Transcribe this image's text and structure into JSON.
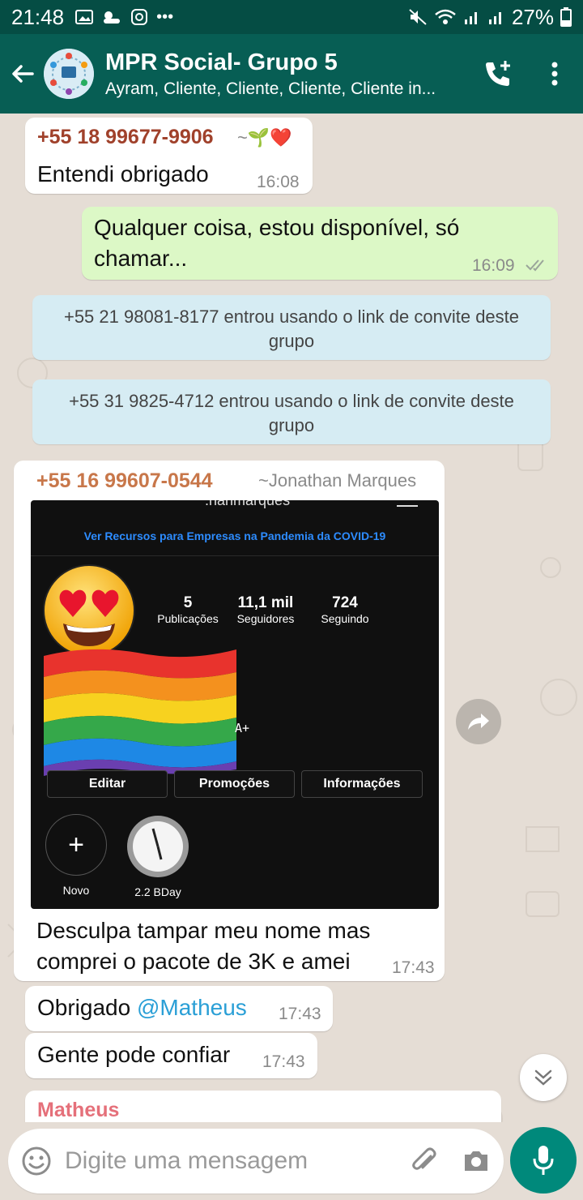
{
  "status_bar": {
    "time": "21:48",
    "battery": "27%"
  },
  "header": {
    "title": "MPR Social- Grupo 5",
    "subtitle": "Ayram, Cliente, Cliente, Cliente, Cliente in..."
  },
  "messages": [
    {
      "sender": "+55 18 99677-9906",
      "alias": "~🌱❤️",
      "text": "Entendi obrigado",
      "time": "16:08"
    },
    {
      "text": "Qualquer coisa, estou disponível, só chamar...",
      "time": "16:09",
      "outgoing": true
    },
    {
      "system": "+55 21 98081-8177 entrou usando o link de convite deste grupo"
    },
    {
      "system": "+55 31 9825-4712 entrou usando o link de convite deste grupo"
    },
    {
      "sender": "+55 16 99607-0544",
      "alias": "~Jonathan Marques",
      "text": "Desculpa tampar meu nome mas comprei o pacote de 3K e amei",
      "time": "17:43"
    },
    {
      "text_prefix": "Obrigado ",
      "mention": "@Matheus",
      "time": "17:43"
    },
    {
      "text": "Gente pode confiar",
      "time": "17:43"
    },
    {
      "sender": "Matheus"
    }
  ],
  "insta": {
    "banner": "Ver Recursos para Empresas na Pandemia da COVID-19",
    "username_fragment": ".hanmarques",
    "stats": [
      {
        "num": "5",
        "label": "Publicações"
      },
      {
        "num": "11,1 mil",
        "label": "Seguidores"
      },
      {
        "num": "724",
        "label": "Seguindo"
      }
    ],
    "buttons": [
      "Editar",
      "Promoções",
      "Informações"
    ],
    "side_text": "A+",
    "highlights": [
      {
        "label": "Novo",
        "symbol": "+"
      },
      {
        "label": "2.2 BDay"
      }
    ]
  },
  "input": {
    "placeholder": "Digite uma mensagem"
  },
  "colors": {
    "header": "#075e54",
    "status_bar": "#054d44",
    "outgoing_bubble": "#dcf8c6",
    "system_bubble": "#d6ecf3",
    "mention": "#2a9fd6",
    "mic_button": "#00897b"
  },
  "icons": [
    "back-arrow-icon",
    "add-call-icon",
    "more-options-icon",
    "forward-icon",
    "scroll-down-icon",
    "emoji-icon",
    "attach-icon",
    "camera-icon",
    "mic-icon"
  ]
}
